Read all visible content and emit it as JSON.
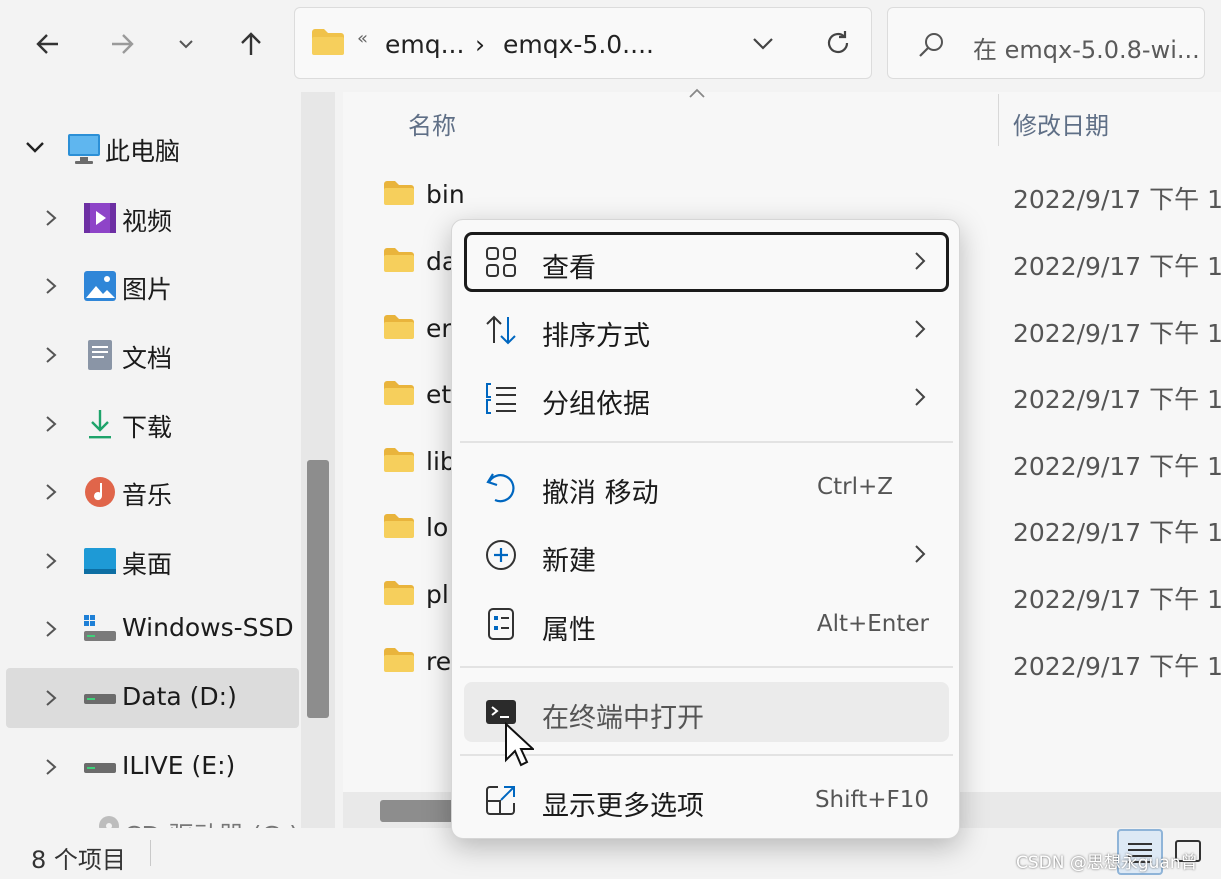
{
  "nav": {
    "back": "←",
    "forward": "→",
    "recent": "⌄",
    "up": "↑"
  },
  "address": {
    "overflow": "«",
    "segment1": "emq...",
    "separator": "›",
    "segment2": "emqx-5.0....",
    "dropdown": "⌄"
  },
  "search": {
    "placeholder": "在 emqx-5.0.8-wi..."
  },
  "sidebar": {
    "this_pc": "此电脑",
    "items": [
      {
        "label": "视频"
      },
      {
        "label": "图片"
      },
      {
        "label": "文档"
      },
      {
        "label": "下载"
      },
      {
        "label": "音乐"
      },
      {
        "label": "桌面"
      },
      {
        "label": "Windows-SSD"
      },
      {
        "label": "Data (D:)"
      },
      {
        "label": "ILIVE (E:)"
      },
      {
        "label": "CD 驱动器 (G:)"
      }
    ]
  },
  "columns": {
    "name": "名称",
    "date": "修改日期"
  },
  "files": [
    {
      "name": "bin",
      "date": "2022/9/17 下午 1"
    },
    {
      "name": "da",
      "date": "2022/9/17 下午 1"
    },
    {
      "name": "er",
      "date": "2022/9/17 下午 1"
    },
    {
      "name": "et",
      "date": "2022/9/17 下午 1"
    },
    {
      "name": "lib",
      "date": "2022/9/17 下午 1"
    },
    {
      "name": "lo",
      "date": "2022/9/17 下午 1"
    },
    {
      "name": "pl",
      "date": "2022/9/17 下午 1"
    },
    {
      "name": "re",
      "date": "2022/9/17 下午 1"
    }
  ],
  "menu": {
    "view": "查看",
    "sort": "排序方式",
    "group": "分组依据",
    "undo": "撤消 移动",
    "undo_shortcut": "Ctrl+Z",
    "new": "新建",
    "properties": "属性",
    "properties_shortcut": "Alt+Enter",
    "terminal": "在终端中打开",
    "more": "显示更多选项",
    "more_shortcut": "Shift+F10"
  },
  "status": {
    "count": "8 个项目"
  },
  "watermark": "CSDN @思想永guan曾",
  "colors": {
    "accent": "#0067c0",
    "folder": "#f0c24a"
  }
}
